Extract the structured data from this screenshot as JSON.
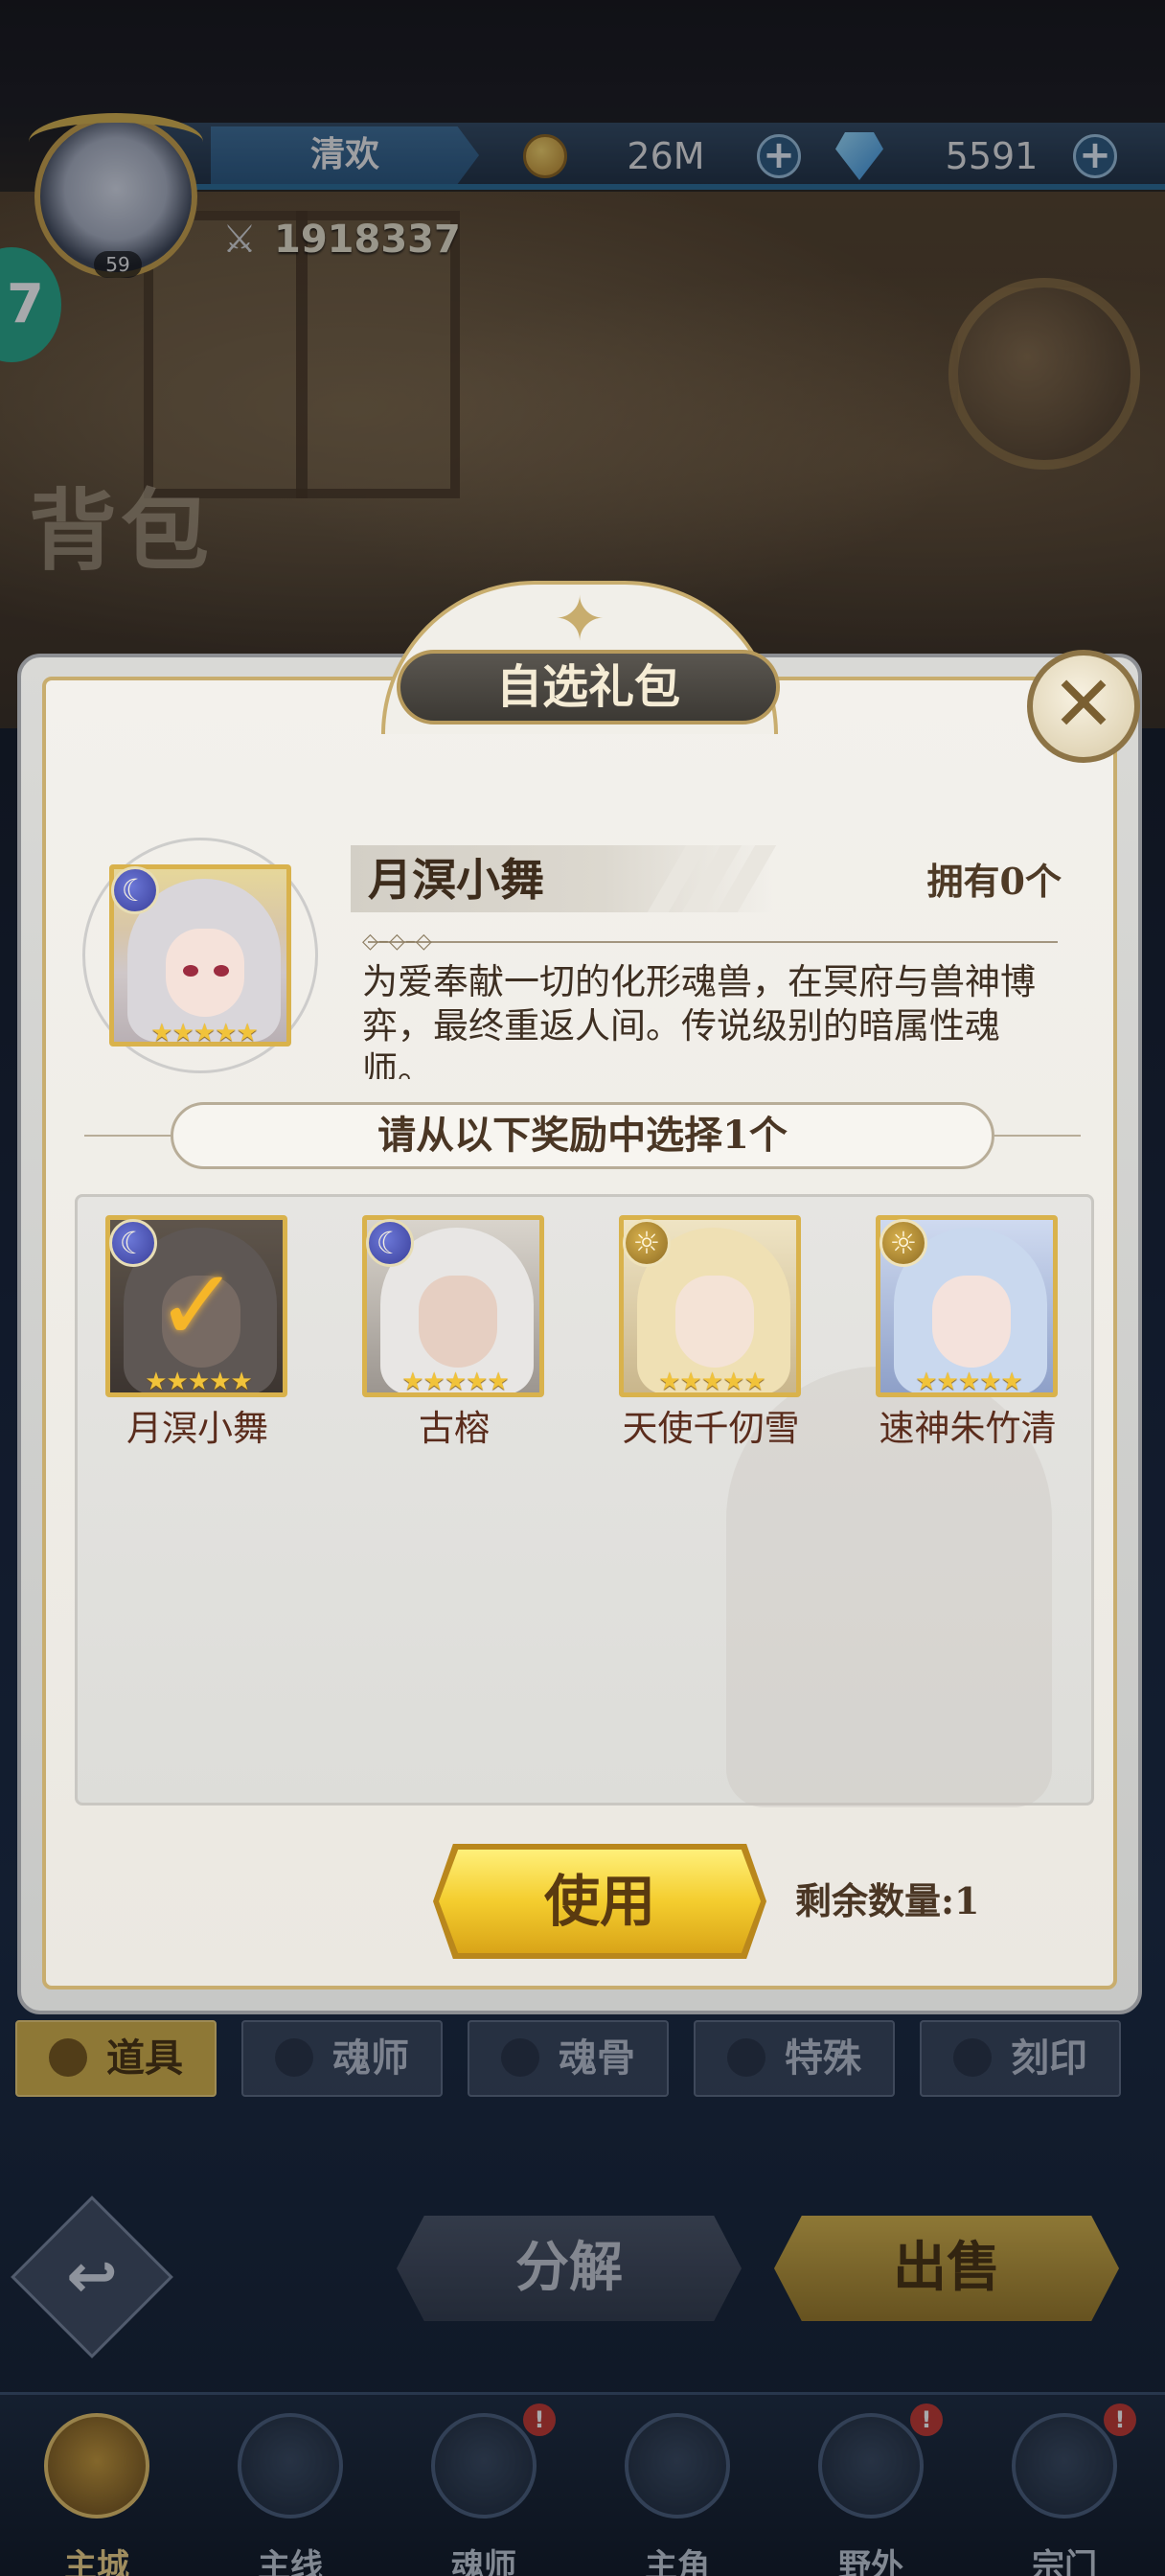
{
  "hud": {
    "player_name": "清欢",
    "level": "59",
    "coins": "26M",
    "gems": "5591",
    "power": "1918337",
    "side_badge": "7"
  },
  "page": {
    "title": "背包"
  },
  "modal": {
    "title": "自选礼包",
    "close_label": "✕",
    "item": {
      "name": "月溟小舞",
      "owned": "拥有0个",
      "description": "为爱奉献一切的化形魂兽，在冥府与兽神博弈，最终重返人间。传说级别的暗属性魂师。",
      "stars": "★★★★★"
    },
    "choose_prompt": "请从以下奖励中选择1个",
    "rewards": [
      {
        "name": "月溟小舞",
        "element": "moon-icon",
        "stars": "★★★★★",
        "selected": true
      },
      {
        "name": "古榕",
        "element": "moon-icon",
        "stars": "★★★★★",
        "selected": false
      },
      {
        "name": "天使千仞雪",
        "element": "sun-icon",
        "stars": "★★★★★",
        "selected": false
      },
      {
        "name": "速神朱竹清",
        "element": "sun-icon",
        "stars": "★★★★★",
        "selected": false
      }
    ],
    "use_label": "使用",
    "remaining": "剩余数量:1"
  },
  "tabs": [
    {
      "label": "道具",
      "active": true
    },
    {
      "label": "魂师",
      "active": false
    },
    {
      "label": "魂骨",
      "active": false
    },
    {
      "label": "特殊",
      "active": false
    },
    {
      "label": "刻印",
      "active": false
    }
  ],
  "actions": {
    "decompose": "分解",
    "sell": "出售"
  },
  "nav": [
    {
      "label": "主城",
      "active": true,
      "badge": ""
    },
    {
      "label": "主线",
      "active": false,
      "badge": ""
    },
    {
      "label": "魂师",
      "active": false,
      "badge": "!"
    },
    {
      "label": "主角",
      "active": false,
      "badge": ""
    },
    {
      "label": "野外",
      "active": false,
      "badge": "!"
    },
    {
      "label": "宗门",
      "active": false,
      "badge": "!"
    }
  ],
  "colors": {
    "gold": "#d9b24c",
    "panel": "#f3f1ec",
    "accent_blue": "#2c6c96"
  }
}
